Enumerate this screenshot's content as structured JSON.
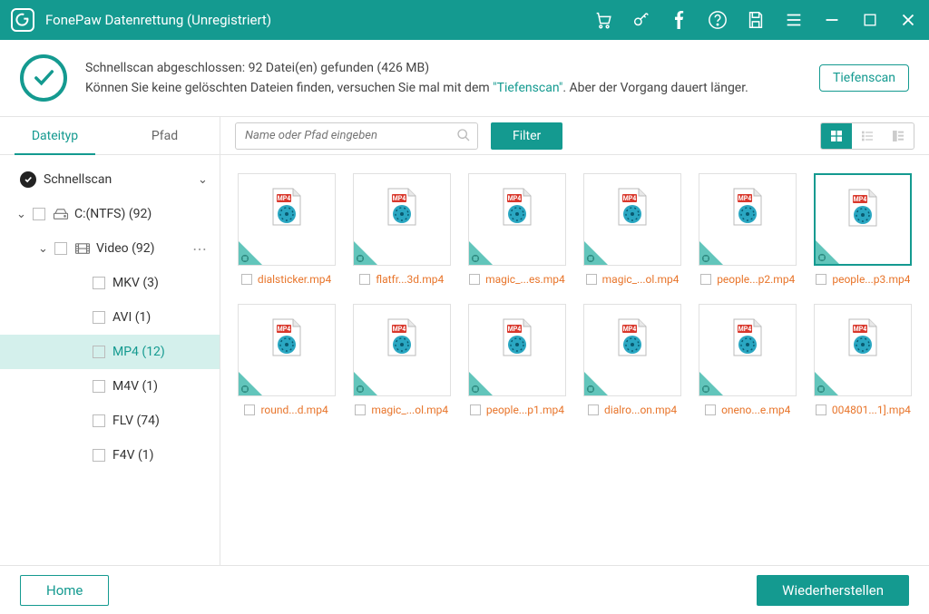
{
  "title": "FonePaw Datenrettung (Unregistriert)",
  "status": {
    "line1": "Schnellscan abgeschlossen: 92 Datei(en) gefunden (426 MB)",
    "line2a": "Können Sie keine gelöschten Dateien finden, versuchen Sie mal mit dem ",
    "link": "\"Tiefenscan\"",
    "line2b": ". Aber der Vorgang dauert länger.",
    "button": "Tiefenscan"
  },
  "tabs": {
    "filetype": "Dateityp",
    "path": "Pfad"
  },
  "tree": {
    "quick": "Schnellscan",
    "drive": "C:(NTFS) (92)",
    "video": "Video (92)",
    "leaves": {
      "mkv": "MKV (3)",
      "avi": "AVI (1)",
      "mp4": "MP4 (12)",
      "m4v": "M4V (1)",
      "flv": "FLV (74)",
      "f4v": "F4V (1)"
    }
  },
  "toolbar": {
    "search_placeholder": "Name oder Pfad eingeben",
    "filter": "Filter"
  },
  "files": [
    {
      "name": "dialsticker.mp4"
    },
    {
      "name": "flatfr...3d.mp4"
    },
    {
      "name": "magic_...es.mp4"
    },
    {
      "name": "magic_...ol.mp4"
    },
    {
      "name": "people...p2.mp4"
    },
    {
      "name": "people...p3.mp4"
    },
    {
      "name": "round...d.mp4"
    },
    {
      "name": "magic_...ol.mp4"
    },
    {
      "name": "people...p1.mp4"
    },
    {
      "name": "dialro...on.mp4"
    },
    {
      "name": "oneno...e.mp4"
    },
    {
      "name": "004801...1].mp4"
    }
  ],
  "footer": {
    "home": "Home",
    "recover": "Wiederherstellen"
  },
  "colors": {
    "accent": "#149a90",
    "file_label": "#e8752b"
  }
}
